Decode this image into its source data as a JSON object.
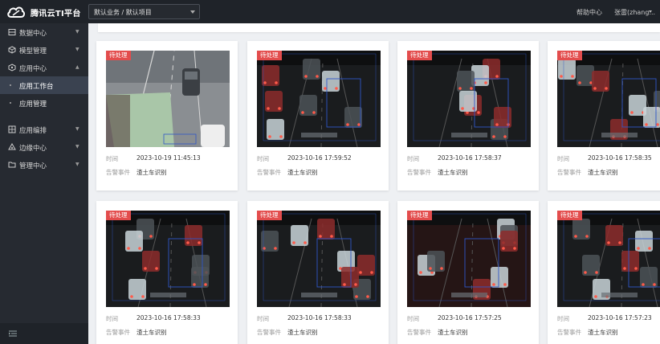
{
  "app": {
    "brand": "腾讯云TI平台",
    "logo_icon": "cloud-logo-icon"
  },
  "topbar": {
    "project_select": "默认业务 / 默认项目",
    "help": "帮助中心",
    "user": "张雷(zhang..."
  },
  "sidebar": {
    "items": [
      {
        "label": "数据中心",
        "icon": "database-icon",
        "expanded": false
      },
      {
        "label": "模型管理",
        "icon": "cube-icon",
        "expanded": false
      },
      {
        "label": "应用中心",
        "icon": "app-box-icon",
        "expanded": true
      },
      {
        "label": "应用编排",
        "icon": "flow-icon",
        "expanded": false
      },
      {
        "label": "边缘中心",
        "icon": "edge-icon",
        "expanded": false
      },
      {
        "label": "管理中心",
        "icon": "folder-icon",
        "expanded": false
      }
    ],
    "sub_items": [
      {
        "label": "应用工作台",
        "active": true
      },
      {
        "label": "应用管理",
        "active": false
      }
    ]
  },
  "cards": [
    {
      "badge": "待处理",
      "time_label": "时间",
      "time": "2023-10-19 11:45:13",
      "event_label": "告警事件",
      "event": "渣土车识别",
      "scene": "day"
    },
    {
      "badge": "待处理",
      "time_label": "时间",
      "time": "2023-10-16 17:59:52",
      "event_label": "告警事件",
      "event": "渣土车识别",
      "scene": "night"
    },
    {
      "badge": "待处理",
      "time_label": "时间",
      "time": "2023-10-16 17:58:37",
      "event_label": "告警事件",
      "event": "渣土车识别",
      "scene": "night"
    },
    {
      "badge": "待处理",
      "time_label": "时间",
      "time": "2023-10-16 17:58:35",
      "event_label": "告警事件",
      "event": "渣土车识别",
      "scene": "night"
    },
    {
      "badge": "待处理",
      "time_label": "时间",
      "time": "2023-10-16 17:58:33",
      "event_label": "告警事件",
      "event": "渣土车识别",
      "scene": "night"
    },
    {
      "badge": "待处理",
      "time_label": "时间",
      "time": "2023-10-16 17:58:33",
      "event_label": "告警事件",
      "event": "渣土车识别",
      "scene": "night"
    },
    {
      "badge": "待处理",
      "time_label": "时间",
      "time": "2023-10-16 17:57:25",
      "event_label": "告警事件",
      "event": "渣土车识别",
      "scene": "night-red"
    },
    {
      "badge": "待处理",
      "time_label": "时间",
      "time": "2023-10-16 17:57:23",
      "event_label": "告警事件",
      "event": "渣土车识别",
      "scene": "night"
    }
  ],
  "colors": {
    "badge": "#e34d4d",
    "sidebar": "#262a31",
    "topbar": "#1f2329",
    "active": "#3a4250"
  }
}
